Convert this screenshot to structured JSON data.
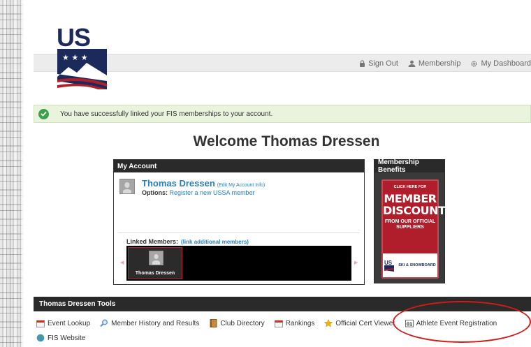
{
  "topnav": {
    "sign_out": "Sign Out",
    "membership": "Membership",
    "dashboard": "My Dashboard"
  },
  "alert": {
    "message": "You have successfully linked your FIS memberships to your account."
  },
  "welcome": "Welcome Thomas Dressen",
  "account": {
    "header": "My Account",
    "name": "Thomas Dressen",
    "edit_link": "(Edit My Account Info)",
    "options_label": "Options:",
    "options_link": "Register a new USSA member",
    "linked_label": "Linked Members:",
    "linked_link": "(link additional members)",
    "linked_members": [
      "Thomas Dressen"
    ]
  },
  "benefits": {
    "header": "Membership Benefits",
    "promo_click": "CLICK HERE FOR",
    "promo_main": "MEMBER DISCOUNTS",
    "promo_from": "FROM OUR OFFICIAL SUPPLIERS",
    "promo_brand": "SKI & SNOWBOARD"
  },
  "tools": {
    "header": "Thomas Dressen Tools",
    "items": [
      {
        "label": "Event Lookup",
        "icon": "calendar-icon"
      },
      {
        "label": "Member History and Results",
        "icon": "magnifier-icon"
      },
      {
        "label": "Club Directory",
        "icon": "book-icon"
      },
      {
        "label": "Rankings",
        "icon": "calendar-icon"
      },
      {
        "label": "Official Cert Viewer",
        "icon": "star-icon"
      },
      {
        "label": "Athlete Event Registration",
        "icon": "01-calendar-icon"
      },
      {
        "label": "FIS Website",
        "icon": "globe-icon"
      }
    ]
  },
  "colors": {
    "link": "#2a7fb8",
    "brand_red": "#b01e2b",
    "brand_navy": "#1b2a5a",
    "success": "#3ba24a",
    "annotation": "#d11b1b"
  }
}
